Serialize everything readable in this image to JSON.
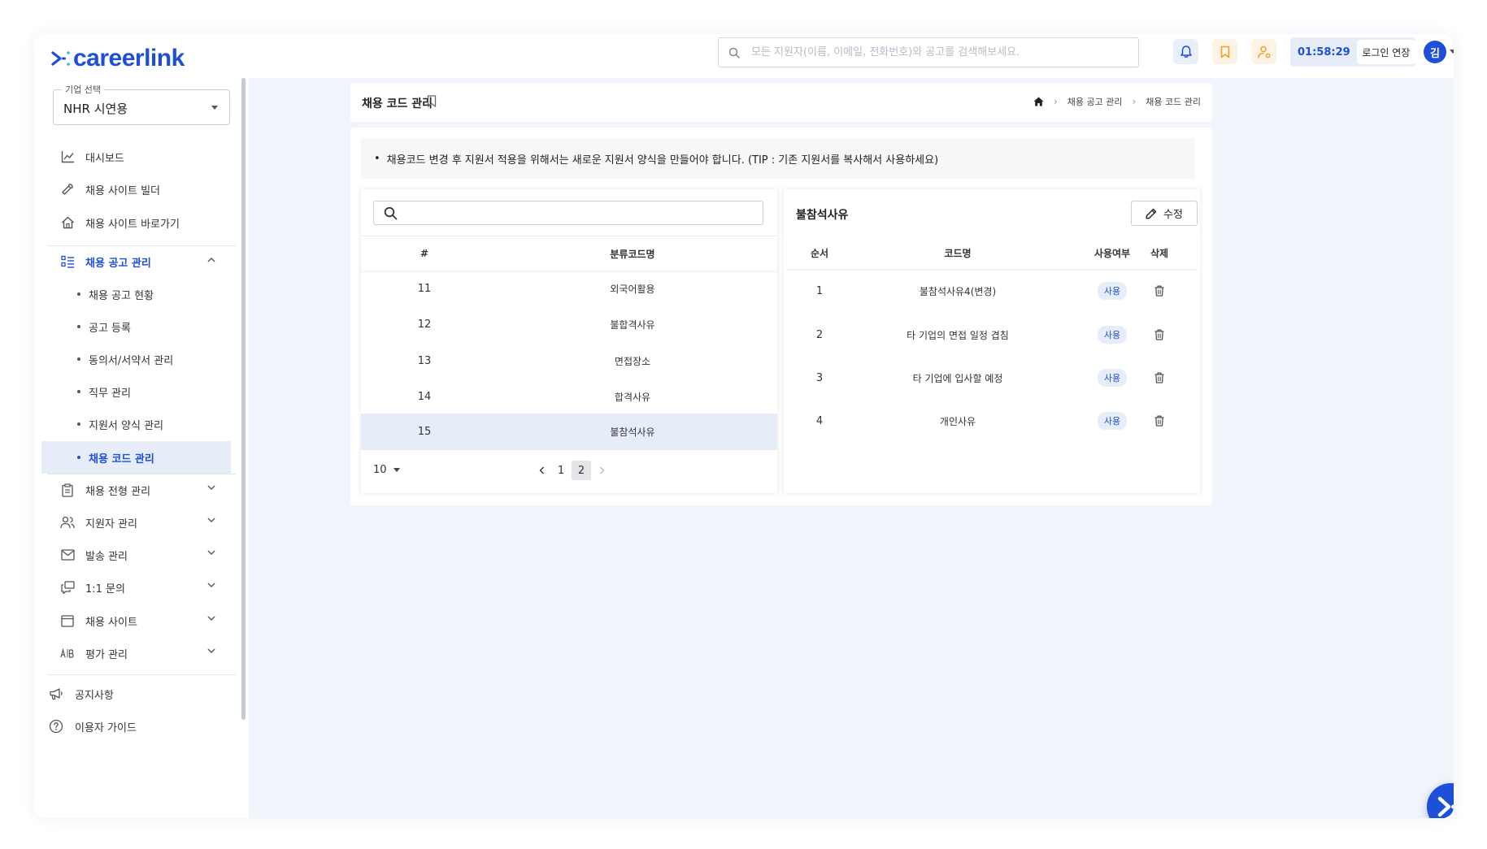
{
  "header": {
    "logo_text": "careerlink",
    "search_placeholder": "모든 지원자(이름, 이메일, 전화번호)와 공고를 검색해보세요.",
    "timer": "01:58:29",
    "extend_label": "로그인 연장",
    "avatar_initial": "김",
    "brand_color": "#1d4fd8"
  },
  "sidebar": {
    "company_legend": "기업 선택",
    "company_value": "NHR 시연용",
    "items": [
      {
        "label": "대시보드",
        "icon": "dashboard-chart-icon"
      },
      {
        "label": "채용 사이트 빌더",
        "icon": "wrench-icon"
      },
      {
        "label": "채용 사이트 바로가기",
        "icon": "home-icon"
      },
      {
        "label": "채용 공고 관리",
        "icon": "list-icon",
        "expanded": true
      }
    ],
    "sub_items": [
      {
        "label": "채용 공고 현황"
      },
      {
        "label": "공고 등록"
      },
      {
        "label": "동의서/서약서 관리"
      },
      {
        "label": "직무 관리"
      },
      {
        "label": "지원서 양식 관리"
      },
      {
        "label": "채용 코드 관리",
        "active": true
      }
    ],
    "more_items": [
      {
        "label": "채용 전형 관리",
        "icon": "clipboard-icon"
      },
      {
        "label": "지원자 관리",
        "icon": "users-icon"
      },
      {
        "label": "발송 관리",
        "icon": "mail-icon"
      },
      {
        "label": "1:1 문의",
        "icon": "chat-icon"
      },
      {
        "label": "채용 사이트",
        "icon": "browser-icon"
      },
      {
        "label": "평가 관리",
        "icon": "ab-icon"
      }
    ],
    "footer": [
      {
        "label": "공지사항",
        "icon": "megaphone-icon"
      },
      {
        "label": "이용자 가이드",
        "icon": "help-circle-icon"
      }
    ]
  },
  "page": {
    "title": "채용 코드 관리",
    "breadcrumb": [
      "채용 공고 관리",
      "채용 코드 관리"
    ],
    "notice": "채용코드 변경 후 지원서 적용을 위해서는 새로운 지원서 양식을 만들어야 합니다. (TIP : 기존 지원서를 복사해서 사용하세요)"
  },
  "category_table": {
    "search_value": "",
    "columns": [
      "#",
      "분류코드명"
    ],
    "rows": [
      {
        "num": "11",
        "name": "외국어활용"
      },
      {
        "num": "12",
        "name": "불합격사유"
      },
      {
        "num": "13",
        "name": "면접장소"
      },
      {
        "num": "14",
        "name": "합격사유"
      },
      {
        "num": "15",
        "name": "불참석사유",
        "selected": true
      }
    ],
    "page_size": "10",
    "pages": [
      "1",
      "2"
    ],
    "current_page": "2"
  },
  "code_table": {
    "title": "불참석사유",
    "edit_label": "수정",
    "columns": [
      "순서",
      "코드명",
      "사용여부",
      "삭제"
    ],
    "rows": [
      {
        "order": "1",
        "name": "불참석사유4(변경)",
        "status": "사용"
      },
      {
        "order": "2",
        "name": "타 기업의 면접 일정 겹침",
        "status": "사용"
      },
      {
        "order": "3",
        "name": "타 기업에 입사할 예정",
        "status": "사용"
      },
      {
        "order": "4",
        "name": "개인사유",
        "status": "사용"
      }
    ]
  }
}
